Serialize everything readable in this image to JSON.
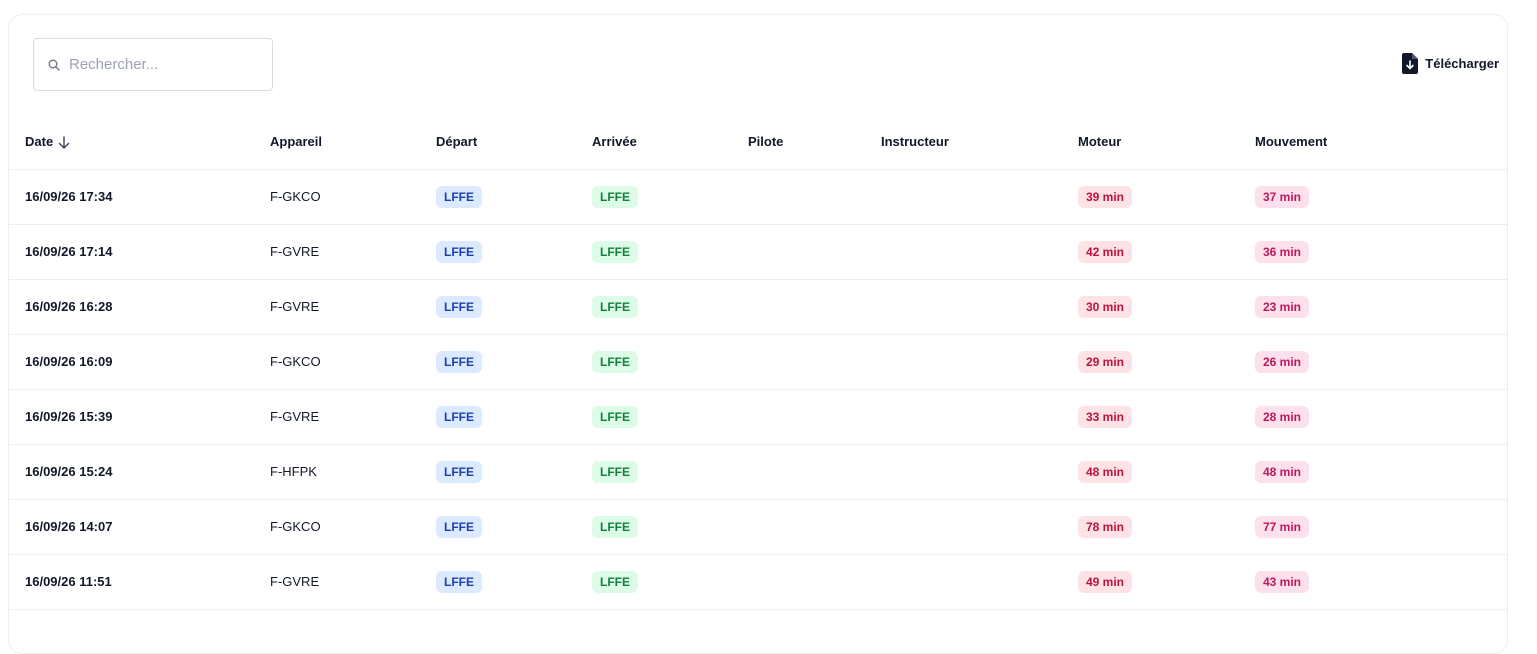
{
  "search": {
    "placeholder": "Rechercher..."
  },
  "download_label": "Télécharger",
  "columns": {
    "date": "Date",
    "appareil": "Appareil",
    "depart": "Départ",
    "arrivee": "Arrivée",
    "pilote": "Pilote",
    "instructeur": "Instructeur",
    "moteur": "Moteur",
    "mouvement": "Mouvement"
  },
  "rows": [
    {
      "date": "16/09/26 17:34",
      "appareil": "F-GKCO",
      "depart": "LFFE",
      "arrivee": "LFFE",
      "pilote": "",
      "instructeur": "",
      "moteur": "39 min",
      "mouvement": "37 min"
    },
    {
      "date": "16/09/26 17:14",
      "appareil": "F-GVRE",
      "depart": "LFFE",
      "arrivee": "LFFE",
      "pilote": "",
      "instructeur": "",
      "moteur": "42 min",
      "mouvement": "36 min"
    },
    {
      "date": "16/09/26 16:28",
      "appareil": "F-GVRE",
      "depart": "LFFE",
      "arrivee": "LFFE",
      "pilote": "",
      "instructeur": "",
      "moteur": "30 min",
      "mouvement": "23 min"
    },
    {
      "date": "16/09/26 16:09",
      "appareil": "F-GKCO",
      "depart": "LFFE",
      "arrivee": "LFFE",
      "pilote": "",
      "instructeur": "",
      "moteur": "29 min",
      "mouvement": "26 min"
    },
    {
      "date": "16/09/26 15:39",
      "appareil": "F-GVRE",
      "depart": "LFFE",
      "arrivee": "LFFE",
      "pilote": "",
      "instructeur": "",
      "moteur": "33 min",
      "mouvement": "28 min"
    },
    {
      "date": "16/09/26 15:24",
      "appareil": "F-HFPK",
      "depart": "LFFE",
      "arrivee": "LFFE",
      "pilote": "",
      "instructeur": "",
      "moteur": "48 min",
      "mouvement": "48 min"
    },
    {
      "date": "16/09/26 14:07",
      "appareil": "F-GKCO",
      "depart": "LFFE",
      "arrivee": "LFFE",
      "pilote": "",
      "instructeur": "",
      "moteur": "78 min",
      "mouvement": "77 min"
    },
    {
      "date": "16/09/26 11:51",
      "appareil": "F-GVRE",
      "depart": "LFFE",
      "arrivee": "LFFE",
      "pilote": "",
      "instructeur": "",
      "moteur": "49 min",
      "mouvement": "43 min"
    },
    {
      "date": "",
      "appareil": "",
      "depart": "",
      "arrivee": "",
      "pilote": "",
      "instructeur": "",
      "moteur": "",
      "mouvement": ""
    }
  ],
  "colors": {
    "depart_badge_bg": "#dbeafe",
    "depart_badge_fg": "#1e40af",
    "arrivee_badge_bg": "#dcfce7",
    "arrivee_badge_fg": "#15803d",
    "moteur_badge_bg": "#fde2e6",
    "moteur_badge_fg": "#be123c",
    "mouvement_badge_bg": "#fce0ec",
    "mouvement_badge_fg": "#be185d"
  },
  "icons": {
    "search": "search-icon",
    "download": "file-download-icon",
    "sort": "arrow-down-icon"
  }
}
